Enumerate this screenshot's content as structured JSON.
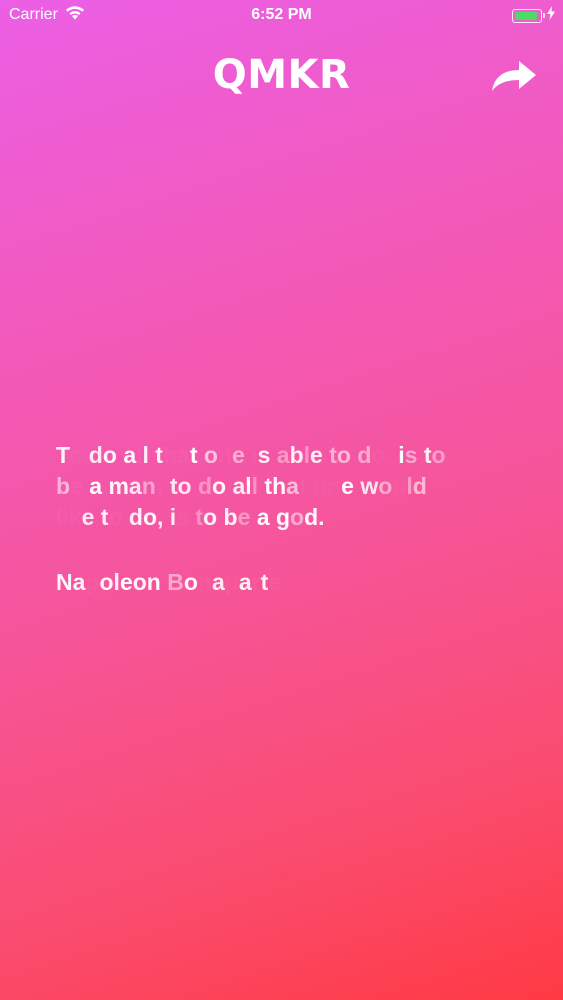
{
  "status_bar": {
    "carrier": "Carrier",
    "time": "6:52 PM",
    "battery_color": "#4cd964"
  },
  "header": {
    "logo": "QMKR",
    "share_icon": "share-arrow-icon"
  },
  "quote": {
    "lines": [
      "To do all that one is able to do, is to",
      "be a man; to do all that one would",
      "like to do, is to be a god."
    ],
    "author": "Napoleon Bonaparte"
  },
  "background": {
    "top_color": "#ec5fe6",
    "bottom_color": "#ff3a44"
  }
}
